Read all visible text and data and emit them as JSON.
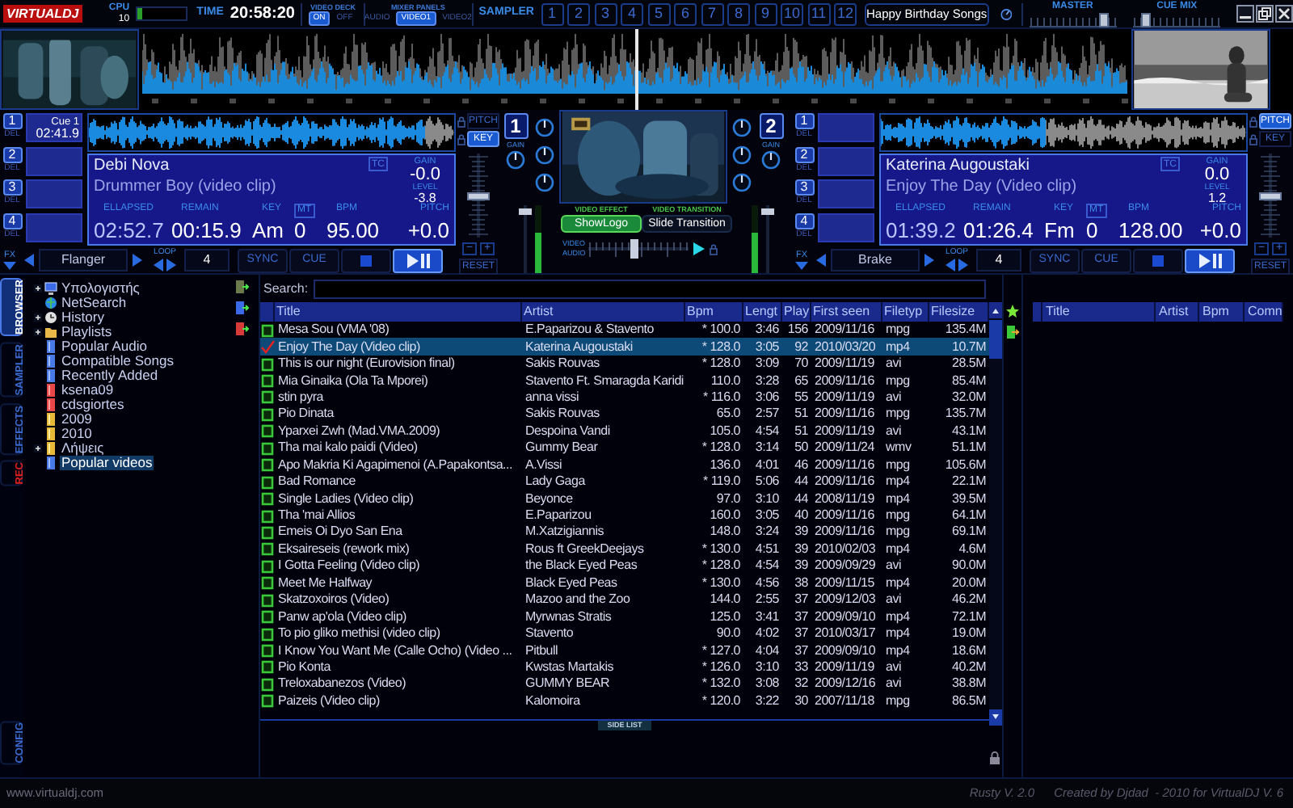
{
  "top_bar": {
    "logo": "VIRTUALDJ",
    "cpu": {
      "label": "CPU",
      "value": "10",
      "level": 0.1
    },
    "time": {
      "label": "TIME",
      "value": "20:58:20"
    },
    "video_deck": {
      "label": "VIDEO DECK",
      "options": [
        {
          "label": "ON",
          "selected": true
        },
        {
          "label": "OFF",
          "selected": false
        }
      ]
    },
    "mixer_panels": {
      "label": "MIXER PANELS",
      "options": [
        {
          "label": "AUDIO",
          "selected": false
        },
        {
          "label": "VIDEO1",
          "selected": true
        },
        {
          "label": "VIDEO2",
          "selected": false
        }
      ]
    },
    "sampler": {
      "label": "SAMPLER",
      "pads": [
        "1",
        "2",
        "3",
        "4",
        "5",
        "6",
        "7",
        "8",
        "9",
        "10",
        "11",
        "12"
      ]
    },
    "sample_bank": "Happy Birthday Songs",
    "master": {
      "label": "MASTER",
      "level": 0.9
    },
    "cue_mix": {
      "label": "CUE MIX",
      "level": 0.1
    }
  },
  "overview": {
    "level": 0.5
  },
  "decks": [
    {
      "cues": [
        {
          "number": "1",
          "del": "DEL",
          "name": "Cue 1",
          "time": "02:41.9"
        },
        {
          "number": "2",
          "del": "DEL"
        },
        {
          "number": "3",
          "del": "DEL"
        },
        {
          "number": "4",
          "del": "DEL"
        }
      ],
      "waveform": {
        "level": 0.92
      },
      "artist": "Debi Nova",
      "title": "Drummer Boy (video clip)",
      "tc": "TC",
      "gain": {
        "label": "GAIN",
        "value": "-0.0"
      },
      "level_readout": {
        "label": "LEVEL",
        "value": "-3.8"
      },
      "fields": [
        {
          "kind": "readout",
          "label": "ELLAPSED",
          "value": "02:52.7"
        },
        {
          "kind": "readout",
          "label": "REMAIN",
          "value": "00:15.9"
        },
        {
          "kind": "readout",
          "label": "KEY",
          "value": "Am"
        },
        {
          "kind": "toggle",
          "label": "MT",
          "value": "0"
        },
        {
          "kind": "readout",
          "label": "BPM",
          "value": "95.00"
        },
        {
          "kind": "readout",
          "label": "PITCH",
          "value": "+0.0"
        }
      ],
      "pitch_modes": [
        {
          "label": "PITCH",
          "selected": false
        },
        {
          "label": "KEY",
          "selected": true
        }
      ],
      "pitch": {
        "level": 0.5,
        "minus": "−",
        "plus": "+",
        "reset": "RESET"
      },
      "fx": {
        "label": "FX",
        "name": "Flanger"
      },
      "loop": {
        "label": "LOOP",
        "value": "4"
      },
      "buttons": [
        {
          "kind": "sync",
          "label": "SYNC"
        },
        {
          "kind": "cue",
          "label": "CUE"
        },
        {
          "kind": "stop"
        },
        {
          "kind": "play"
        }
      ],
      "playing": true
    },
    {
      "cues": [
        {
          "number": "1",
          "del": "DEL"
        },
        {
          "number": "2",
          "del": "DEL"
        },
        {
          "number": "3",
          "del": "DEL"
        },
        {
          "number": "4",
          "del": "DEL"
        }
      ],
      "waveform": {
        "level": 0.45
      },
      "artist": "Katerina Augoustaki",
      "title": "Enjoy The Day (Video clip)",
      "tc": "TC",
      "gain": {
        "label": "GAIN",
        "value": "0.0"
      },
      "level_readout": {
        "label": "LEVEL",
        "value": "1.2"
      },
      "fields": [
        {
          "kind": "readout",
          "label": "ELLAPSED",
          "value": "01:39.2"
        },
        {
          "kind": "readout",
          "label": "REMAIN",
          "value": "01:26.4"
        },
        {
          "kind": "readout",
          "label": "KEY",
          "value": "Fm"
        },
        {
          "kind": "toggle",
          "label": "MT",
          "value": "0"
        },
        {
          "kind": "readout",
          "label": "BPM",
          "value": "128.00"
        },
        {
          "kind": "readout",
          "label": "PITCH",
          "value": "+0.0"
        }
      ],
      "pitch_modes": [
        {
          "label": "PITCH",
          "selected": true
        },
        {
          "label": "KEY",
          "selected": false
        }
      ],
      "pitch": {
        "level": 0.5,
        "minus": "−",
        "plus": "+",
        "reset": "RESET"
      },
      "fx": {
        "label": "FX",
        "name": "Brake"
      },
      "loop": {
        "label": "LOOP",
        "value": "4"
      },
      "buttons": [
        {
          "kind": "sync",
          "label": "SYNC"
        },
        {
          "kind": "cue",
          "label": "CUE"
        },
        {
          "kind": "stop"
        },
        {
          "kind": "play"
        }
      ],
      "playing": true
    }
  ],
  "mixer": {
    "channels": [
      {
        "number": "1",
        "gain_label": "GAIN",
        "vu": {
          "level": 0.6
        },
        "volume": {
          "level": 0.95
        }
      },
      {
        "number": "2",
        "gain_label": "GAIN",
        "vu": {
          "level": 0.6
        },
        "volume": {
          "level": 0.95
        }
      }
    ],
    "video_effect": {
      "label": "VIDEO EFFECT",
      "name": "ShowLogo"
    },
    "video_transition": {
      "label": "VIDEO TRANSITION",
      "name": "Slide Transition"
    },
    "crossfader": {
      "labels": [
        "VIDEO",
        "AUDIO"
      ],
      "level": 0.45
    }
  },
  "browser": {
    "tabs": [
      {
        "label": "BROWSER",
        "kind": "normal",
        "selected": true
      },
      {
        "label": "SAMPLER",
        "kind": "normal",
        "selected": false
      },
      {
        "label": "EFFECTS",
        "kind": "normal",
        "selected": false
      },
      {
        "label": "REC",
        "kind": "record",
        "selected": false
      },
      {
        "label": "CONFIG",
        "kind": "normal",
        "selected": false
      }
    ],
    "tree": [
      {
        "label": "Υπολογιστής",
        "kind": "computer",
        "expandable": true,
        "selected": false
      },
      {
        "label": "NetSearch",
        "kind": "globe",
        "expandable": false,
        "selected": false
      },
      {
        "label": "History",
        "kind": "clock",
        "expandable": true,
        "selected": false
      },
      {
        "label": "Playlists",
        "kind": "playlists",
        "expandable": true,
        "selected": false
      },
      {
        "label": "Popular Audio",
        "kind": "virtual",
        "expandable": false,
        "selected": false
      },
      {
        "label": "Compatible Songs",
        "kind": "virtual",
        "expandable": false,
        "selected": false
      },
      {
        "label": "Recently Added",
        "kind": "virtual",
        "expandable": false,
        "selected": false
      },
      {
        "label": "ksena09",
        "kind": "playlist",
        "expandable": false,
        "selected": false
      },
      {
        "label": "cdsgiortes",
        "kind": "playlist",
        "expandable": false,
        "selected": false
      },
      {
        "label": "2009",
        "kind": "folder",
        "expandable": false,
        "selected": false
      },
      {
        "label": "2010",
        "kind": "folder",
        "expandable": false,
        "selected": false
      },
      {
        "label": "Λήψεις",
        "kind": "folder",
        "expandable": true,
        "selected": false
      },
      {
        "label": "Popular videos",
        "kind": "virtual",
        "expandable": false,
        "selected": true
      }
    ],
    "search": {
      "label": "Search:"
    },
    "columns": [
      "Title",
      "Artist",
      "Bpm",
      "Lengt",
      "Play",
      "First seen",
      "Filetyp",
      "Filesize"
    ],
    "rows": [
      {
        "kind": "video",
        "selected": false,
        "title": "Mesa Sou (VMA '08)",
        "artist": "E.Paparizou & Stavento",
        "bpm": "* 100.0",
        "length": "3:46",
        "plays": "156",
        "first_seen": "2009/11/16",
        "filetype": "mpg",
        "filesize": "135.4M"
      },
      {
        "kind": "played",
        "selected": true,
        "title": "Enjoy The Day (Video clip)",
        "artist": "Katerina Augoustaki",
        "bpm": "* 128.0",
        "length": "3:05",
        "plays": "92",
        "first_seen": "2010/03/20",
        "filetype": "mp4",
        "filesize": "10.7M"
      },
      {
        "kind": "video",
        "selected": false,
        "title": "This is our night (Eurovision final)",
        "artist": "Sakis Rouvas",
        "bpm": "* 128.0",
        "length": "3:09",
        "plays": "70",
        "first_seen": "2009/11/19",
        "filetype": "avi",
        "filesize": "28.5M"
      },
      {
        "kind": "video",
        "selected": false,
        "title": "Mia Ginaika (Ola Ta Mporei)",
        "artist": "Stavento Ft. Smaragda Karidi",
        "bpm": "110.0",
        "length": "3:28",
        "plays": "65",
        "first_seen": "2009/11/16",
        "filetype": "mpg",
        "filesize": "85.4M"
      },
      {
        "kind": "video",
        "selected": false,
        "title": "stin pyra",
        "artist": "anna vissi",
        "bpm": "* 116.0",
        "length": "3:06",
        "plays": "55",
        "first_seen": "2009/11/19",
        "filetype": "avi",
        "filesize": "32.0M"
      },
      {
        "kind": "video",
        "selected": false,
        "title": "Pio Dinata",
        "artist": "Sakis Rouvas",
        "bpm": "65.0",
        "length": "2:57",
        "plays": "51",
        "first_seen": "2009/11/16",
        "filetype": "mpg",
        "filesize": "135.7M"
      },
      {
        "kind": "video",
        "selected": false,
        "title": "Yparxei Zwh (Mad.VMA.2009)",
        "artist": "Despoina Vandi",
        "bpm": "105.0",
        "length": "4:54",
        "plays": "51",
        "first_seen": "2009/11/19",
        "filetype": "avi",
        "filesize": "43.1M"
      },
      {
        "kind": "video",
        "selected": false,
        "title": "Tha mai kalo paidi (Video)",
        "artist": "Gummy Bear",
        "bpm": "* 128.0",
        "length": "3:14",
        "plays": "50",
        "first_seen": "2009/11/24",
        "filetype": "wmv",
        "filesize": "51.1M"
      },
      {
        "kind": "video",
        "selected": false,
        "title": "Apo Makria Ki Agapimenoi (A.Papakontsa...",
        "artist": "A.Vissi",
        "bpm": "136.0",
        "length": "4:01",
        "plays": "46",
        "first_seen": "2009/11/16",
        "filetype": "mpg",
        "filesize": "105.6M"
      },
      {
        "kind": "video",
        "selected": false,
        "title": "Bad Romance",
        "artist": "Lady Gaga",
        "bpm": "* 119.0",
        "length": "5:06",
        "plays": "44",
        "first_seen": "2009/11/16",
        "filetype": "mp4",
        "filesize": "22.1M"
      },
      {
        "kind": "video",
        "selected": false,
        "title": "Single Ladies (Video clip)",
        "artist": "Beyonce",
        "bpm": "97.0",
        "length": "3:10",
        "plays": "44",
        "first_seen": "2008/11/19",
        "filetype": "mp4",
        "filesize": "39.5M"
      },
      {
        "kind": "video",
        "selected": false,
        "title": "Tha 'mai Allios",
        "artist": "E.Paparizou",
        "bpm": "160.0",
        "length": "3:05",
        "plays": "40",
        "first_seen": "2009/11/16",
        "filetype": "mpg",
        "filesize": "64.1M"
      },
      {
        "kind": "video",
        "selected": false,
        "title": "Emeis Oi Dyo San Ena",
        "artist": "M.Xatzigiannis",
        "bpm": "148.0",
        "length": "3:24",
        "plays": "39",
        "first_seen": "2009/11/16",
        "filetype": "mpg",
        "filesize": "69.1M"
      },
      {
        "kind": "video",
        "selected": false,
        "title": "Eksaireseis (rework mix)",
        "artist": "Rous ft GreekDeejays",
        "bpm": "* 130.0",
        "length": "4:51",
        "plays": "39",
        "first_seen": "2010/02/03",
        "filetype": "mp4",
        "filesize": "4.6M"
      },
      {
        "kind": "video",
        "selected": false,
        "title": "I Gotta Feeling (Video clip)",
        "artist": "the Black Eyed Peas",
        "bpm": "* 128.0",
        "length": "4:54",
        "plays": "39",
        "first_seen": "2009/09/29",
        "filetype": "avi",
        "filesize": "90.0M"
      },
      {
        "kind": "video",
        "selected": false,
        "title": "Meet Me Halfway",
        "artist": "Black Eyed Peas",
        "bpm": "* 130.0",
        "length": "4:56",
        "plays": "38",
        "first_seen": "2009/11/15",
        "filetype": "mp4",
        "filesize": "20.0M"
      },
      {
        "kind": "video",
        "selected": false,
        "title": "Skatzoxoiros (Video)",
        "artist": "Mazoo and the Zoo",
        "bpm": "144.0",
        "length": "2:55",
        "plays": "37",
        "first_seen": "2009/12/03",
        "filetype": "avi",
        "filesize": "46.2M"
      },
      {
        "kind": "video",
        "selected": false,
        "title": "Panw ap'ola (Video clip)",
        "artist": "Myrwnas Stratis",
        "bpm": "125.0",
        "length": "3:41",
        "plays": "37",
        "first_seen": "2009/09/10",
        "filetype": "mp4",
        "filesize": "72.1M"
      },
      {
        "kind": "video",
        "selected": false,
        "title": "To pio gliko methisi (video clip)",
        "artist": "Stavento",
        "bpm": "90.0",
        "length": "4:02",
        "plays": "37",
        "first_seen": "2010/03/17",
        "filetype": "mp4",
        "filesize": "19.0M"
      },
      {
        "kind": "video",
        "selected": false,
        "title": "I Know You Want Me (Calle Ocho) (Video ...",
        "artist": "Pitbull",
        "bpm": "* 127.0",
        "length": "4:04",
        "plays": "37",
        "first_seen": "2009/09/10",
        "filetype": "mp4",
        "filesize": "18.6M"
      },
      {
        "kind": "video",
        "selected": false,
        "title": "Pio Konta",
        "artist": "Kwstas Martakis",
        "bpm": "* 126.0",
        "length": "3:10",
        "plays": "33",
        "first_seen": "2009/11/19",
        "filetype": "avi",
        "filesize": "40.2M"
      },
      {
        "kind": "video",
        "selected": false,
        "title": "Treloxabanezos (Video)",
        "artist": "GUMMY BEAR",
        "bpm": "* 132.0",
        "length": "3:08",
        "plays": "32",
        "first_seen": "2009/12/16",
        "filetype": "avi",
        "filesize": "38.8M"
      },
      {
        "kind": "video",
        "selected": false,
        "title": "Paizeis (Video clip)",
        "artist": "Kalomoira",
        "bpm": "* 120.0",
        "length": "3:22",
        "plays": "30",
        "first_seen": "2007/11/18",
        "filetype": "mpg",
        "filesize": "86.5M"
      }
    ],
    "side_list": {
      "label": "SIDE LIST",
      "columns": [
        "Title",
        "Artist",
        "Bpm",
        "Comn"
      ]
    }
  },
  "footer": {
    "url": "www.virtualdj.com",
    "credits": [
      "Rusty V. 2.0",
      "Created by Djdad  - 2010 for VirtualDJ V. 6"
    ]
  }
}
